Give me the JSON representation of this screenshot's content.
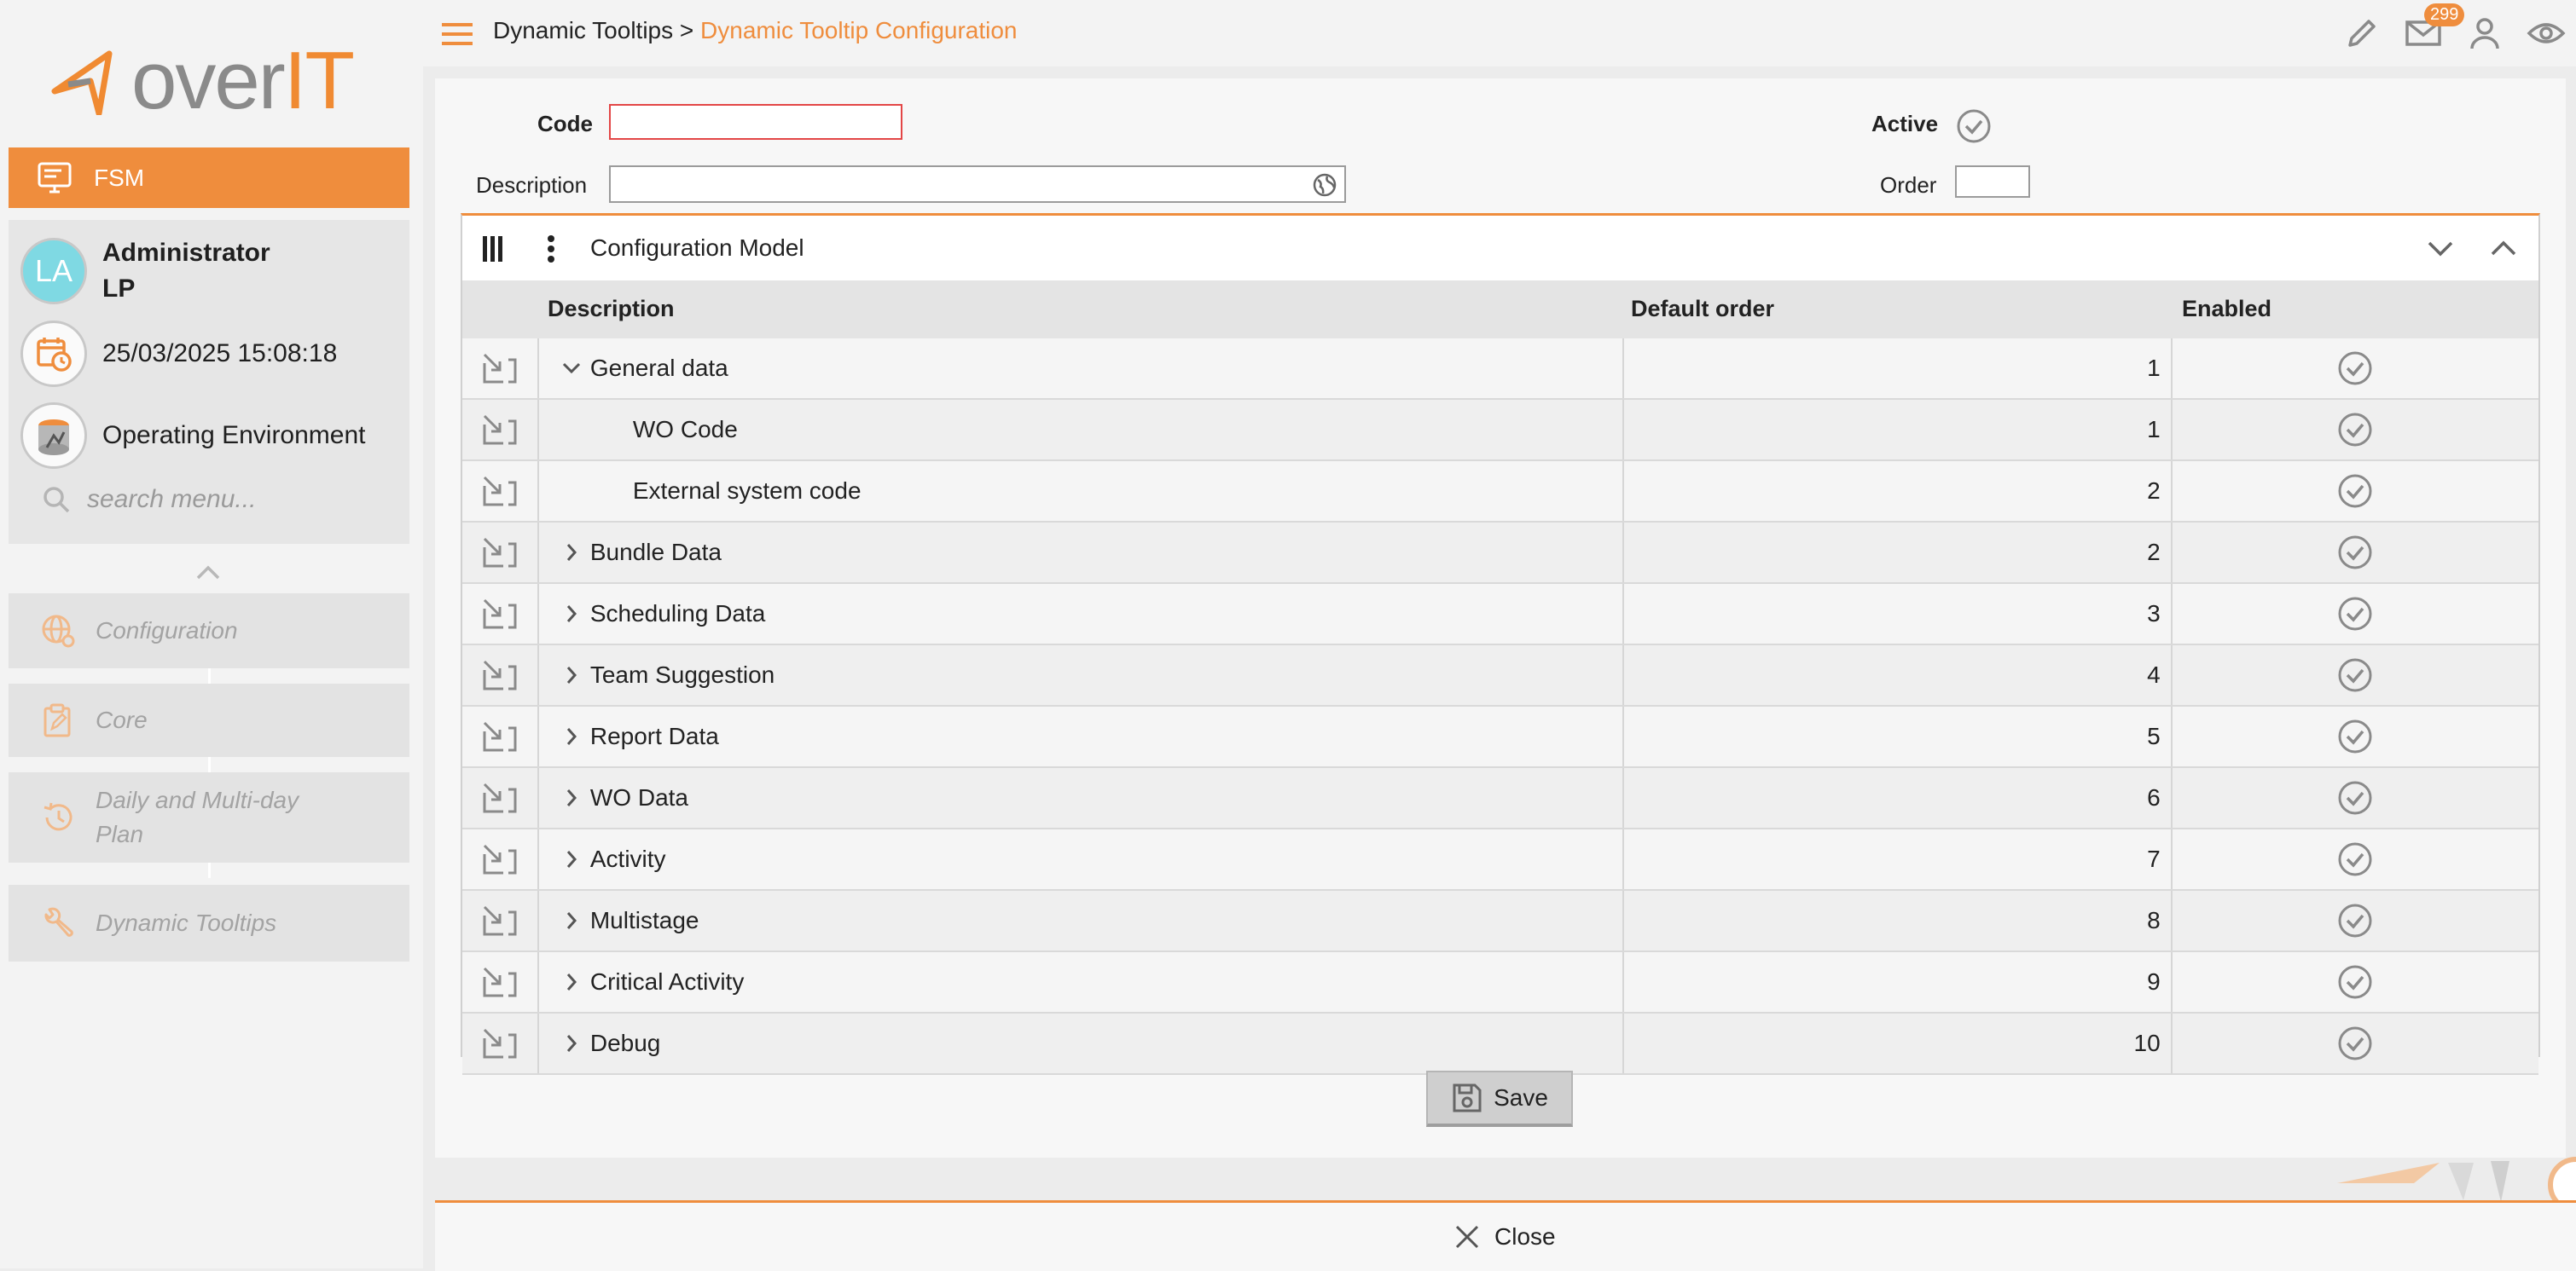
{
  "app": {
    "logo_text_a": "over",
    "logo_text_b": "IT"
  },
  "sidebar": {
    "module_label": "FSM",
    "user_name": "Administrator",
    "user_sub": "LP",
    "avatar_initials": "LA",
    "datetime": "25/03/2025 15:08:18",
    "environment": "Operating Environment",
    "search_placeholder": "search menu...",
    "menu": [
      {
        "label": "Configuration",
        "icon": "globe-settings-icon"
      },
      {
        "label": "Core",
        "icon": "clipboard-edit-icon"
      },
      {
        "label": "Daily and Multi-day Plan",
        "icon": "history-icon"
      },
      {
        "label": "Dynamic Tooltips",
        "icon": "wrench-icon"
      }
    ]
  },
  "topbar": {
    "breadcrumb_parent": "Dynamic Tooltips",
    "breadcrumb_sep": ">",
    "breadcrumb_current": "Dynamic Tooltip Configuration",
    "mail_count": "299"
  },
  "form": {
    "code_label": "Code",
    "code_value": "",
    "description_label": "Description",
    "description_value": "",
    "active_label": "Active",
    "order_label": "Order",
    "order_value": ""
  },
  "grid": {
    "title": "Configuration Model",
    "columns": {
      "description": "Description",
      "default_order": "Default order",
      "enabled": "Enabled"
    },
    "rows": [
      {
        "description": "General data",
        "order": "1",
        "level": 0,
        "expanded": true
      },
      {
        "description": "WO Code",
        "order": "1",
        "level": 1
      },
      {
        "description": "External system code",
        "order": "2",
        "level": 1
      },
      {
        "description": "Bundle Data",
        "order": "2",
        "level": 0,
        "expanded": false
      },
      {
        "description": "Scheduling Data",
        "order": "3",
        "level": 0,
        "expanded": false
      },
      {
        "description": "Team Suggestion",
        "order": "4",
        "level": 0,
        "expanded": false
      },
      {
        "description": "Report Data",
        "order": "5",
        "level": 0,
        "expanded": false
      },
      {
        "description": "WO Data",
        "order": "6",
        "level": 0,
        "expanded": false
      },
      {
        "description": "Activity",
        "order": "7",
        "level": 0,
        "expanded": false
      },
      {
        "description": "Multistage",
        "order": "8",
        "level": 0,
        "expanded": false
      },
      {
        "description": "Critical Activity",
        "order": "9",
        "level": 0,
        "expanded": false
      },
      {
        "description": "Debug",
        "order": "10",
        "level": 0,
        "expanded": false
      }
    ]
  },
  "actions": {
    "save_label": "Save",
    "close_label": "Close"
  },
  "colors": {
    "accent": "#ef8d3d",
    "required_border": "#e34646"
  }
}
